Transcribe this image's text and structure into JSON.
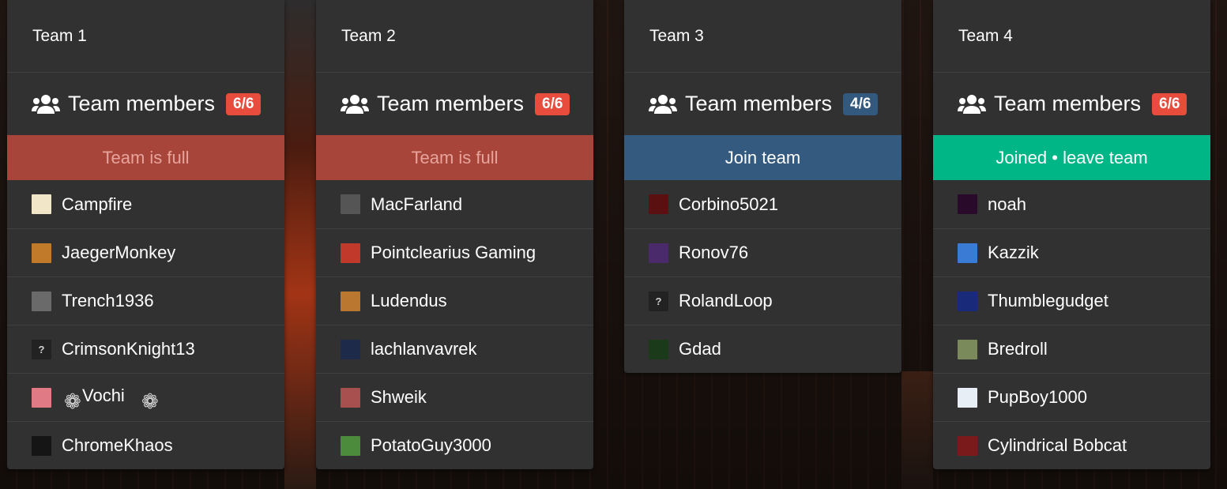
{
  "icons": {
    "members": "users-icon",
    "unknown_avatar": "?"
  },
  "teams": [
    {
      "title": "Team 1",
      "members_label": "Team members",
      "count": "6/6",
      "count_color": "#e74c3c",
      "action_label": "Team is full",
      "action_color": "#a8453a",
      "action_text_color": "#e6a49c",
      "members": [
        {
          "name": "Campfire",
          "avatar_color": "#f2e6c8"
        },
        {
          "name": "JaegerMonkey",
          "avatar_color": "#c07a2a"
        },
        {
          "name": "Trench1936",
          "avatar_color": "#6a6a6a"
        },
        {
          "name": "CrimsonKnight13",
          "avatar_color": "#222222"
        },
        {
          "name": "Vochi",
          "avatar_color": "#e07b86"
        },
        {
          "name": "ChromeKhaos",
          "avatar_color": "#151515"
        }
      ]
    },
    {
      "title": "Team 2",
      "members_label": "Team members",
      "count": "6/6",
      "count_color": "#e74c3c",
      "action_label": "Team is full",
      "action_color": "#a8453a",
      "action_text_color": "#e6a49c",
      "members": [
        {
          "name": "MacFarland",
          "avatar_color": "#555555"
        },
        {
          "name": "Pointclearius Gaming",
          "avatar_color": "#c0392b"
        },
        {
          "name": "Ludendus",
          "avatar_color": "#b9772f"
        },
        {
          "name": "lachlanvavrek",
          "avatar_color": "#1e2a4a"
        },
        {
          "name": "Shweik",
          "avatar_color": "#a85050"
        },
        {
          "name": "PotatoGuy3000",
          "avatar_color": "#4c8a3c"
        }
      ]
    },
    {
      "title": "Team 3",
      "members_label": "Team members",
      "count": "4/6",
      "count_color": "#34597f",
      "action_label": "Join team",
      "action_color": "#355a80",
      "action_text_color": "#ffffff",
      "members": [
        {
          "name": "Corbino5021",
          "avatar_color": "#5a1010"
        },
        {
          "name": "Ronov76",
          "avatar_color": "#4a2a6a"
        },
        {
          "name": "RolandLoop",
          "avatar_color": "#222222"
        },
        {
          "name": "Gdad",
          "avatar_color": "#1a3a1a"
        }
      ]
    },
    {
      "title": "Team 4",
      "members_label": "Team members",
      "count": "6/6",
      "count_color": "#e74c3c",
      "action_label": "Joined • leave team",
      "action_color": "#00b687",
      "action_text_color": "#ffffff",
      "members": [
        {
          "name": "noah",
          "avatar_color": "#2a0a2a"
        },
        {
          "name": "Kazzik",
          "avatar_color": "#3a7bd5"
        },
        {
          "name": "Thumblegudget",
          "avatar_color": "#1a2a7a"
        },
        {
          "name": "Bredroll",
          "avatar_color": "#7a8a5a"
        },
        {
          "name": "PupBoy1000",
          "avatar_color": "#e8eef5"
        },
        {
          "name": "Cylindrical Bobcat",
          "avatar_color": "#7a1a1a"
        }
      ]
    }
  ]
}
